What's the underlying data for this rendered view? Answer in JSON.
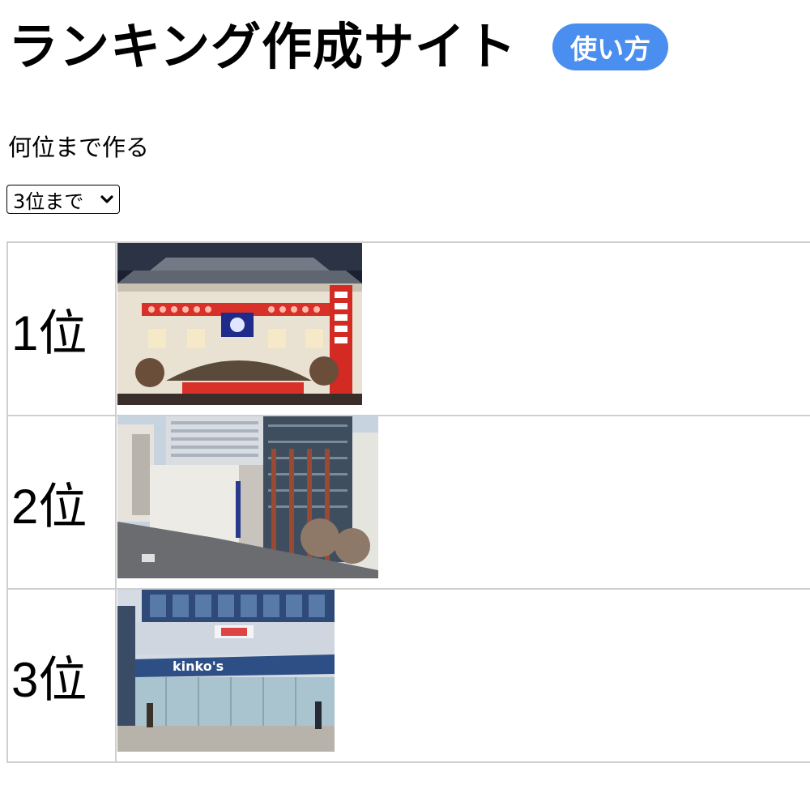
{
  "header": {
    "title": "ランキング作成サイト",
    "howto_label": "使い方",
    "howto_color": "#4a8ef0"
  },
  "rank_count": {
    "label": "何位まで作る",
    "selected": "3位まで",
    "icon": "chevron-down-icon"
  },
  "ranking": {
    "rows": [
      {
        "label": "1位",
        "image": "kabuki-theater-photo"
      },
      {
        "label": "2位",
        "image": "office-building-photo"
      },
      {
        "label": "3位",
        "image": "kinkos-store-photo",
        "image_text": "kinko's"
      }
    ]
  }
}
